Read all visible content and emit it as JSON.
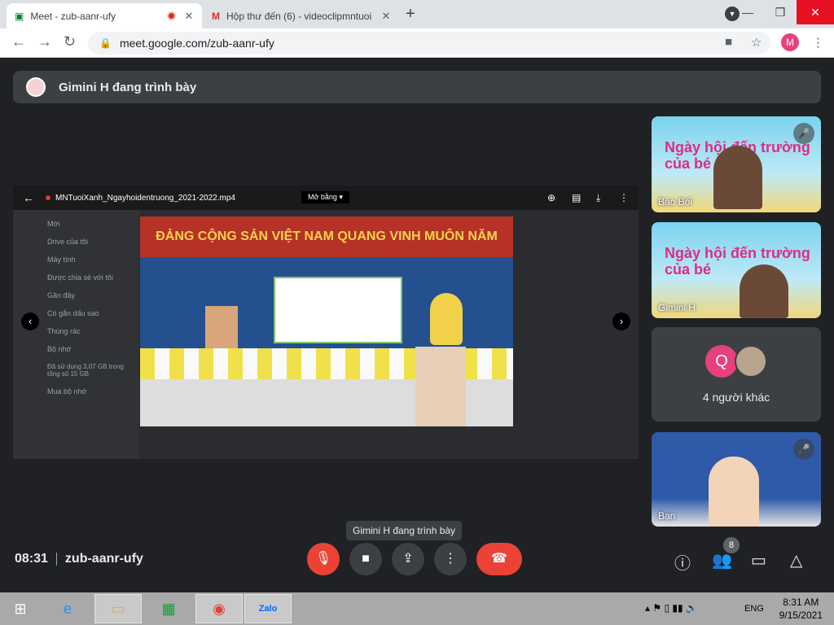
{
  "browser": {
    "tabs": [
      {
        "title": "Meet - zub-aanr-ufy",
        "close": "✕"
      },
      {
        "title": "Hộp thư đến (6) - videoclipmntuoi",
        "close": "✕"
      }
    ],
    "new_tab": "+",
    "url": "meet.google.com/zub-aanr-ufy",
    "profile_initial": "M",
    "window_controls": {
      "minimize": "—",
      "restore": "❐",
      "close": "✕"
    }
  },
  "presenter_bar": {
    "text": "Gimini H đang trình bày"
  },
  "shared_screen": {
    "file_name": "MNTuoiXanh_Ngayhoidentruong_2021-2022.mp4",
    "open_with": "Mở bằng",
    "banner_text": "ĐẢNG CỘNG SẢN VIỆT NAM QUANG VINH MUÔN NĂM",
    "drive_sidebar": [
      "Mới",
      "Drive của tôi",
      "Máy tính",
      "Được chia sẻ với tôi",
      "Gần đây",
      "Có gắn dấu sao",
      "Thùng rác",
      "Bộ nhớ",
      "Đã sử dụng 3,07 GB trong tổng số 15 GB",
      "Mua bộ nhớ"
    ]
  },
  "participants": [
    {
      "name": "Bảo Bối",
      "muted": true,
      "slide_title": "Ngày hội đến trường của bé"
    },
    {
      "name": "Gimini H",
      "muted": false,
      "slide_title": "Ngày hội đến trường của bé"
    },
    {
      "name": "Bạn",
      "muted": true
    }
  ],
  "others": {
    "initial": "Q",
    "label": "4 người khác"
  },
  "tooltip": "Gimini H đang trình bày",
  "meeting": {
    "time": "08:31",
    "code": "zub-aanr-ufy"
  },
  "people_count": "8",
  "taskbar": {
    "time": "8:31 AM",
    "date": "9/15/2021",
    "language": "ENG",
    "zalo": "Zalo"
  }
}
